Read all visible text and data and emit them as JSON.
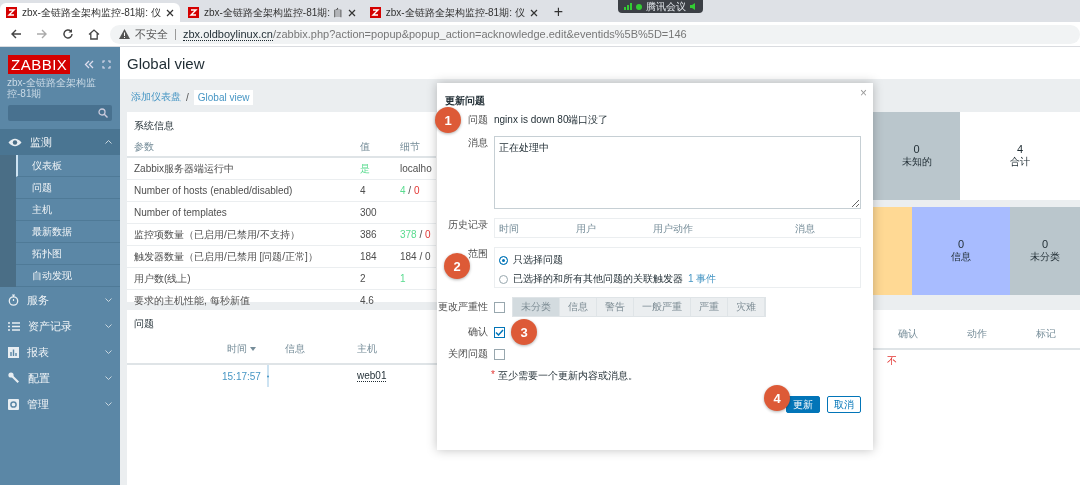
{
  "browser": {
    "tabs": [
      {
        "title": "zbx-全链路全架构监控-81期: 仪",
        "selected": true
      },
      {
        "title": "zbx-全链路全架构监控-81期: 自",
        "selected": false
      },
      {
        "title": "zbx-全链路全架构监控-81期: 仪",
        "selected": false
      }
    ],
    "new_tab": "+",
    "security": "不安全",
    "url_host": "zbx.oldboylinux.cn",
    "url_path": "/zabbix.php?action=popup&popup_action=acknowledge.edit&eventids%5B%5D=146"
  },
  "meeting_indicator": {
    "label": "腾讯会议"
  },
  "sidebar": {
    "logo": "ZABBIX",
    "server_name": "zbx-全链路全架构监控-81期",
    "menu": [
      {
        "label": "监测",
        "expanded": true,
        "children": [
          {
            "label": "仪表板",
            "selected": true
          },
          {
            "label": "问题",
            "selected": false
          },
          {
            "label": "主机",
            "selected": false
          },
          {
            "label": "最新数据",
            "selected": false
          },
          {
            "label": "拓扑图",
            "selected": false
          },
          {
            "label": "自动发现",
            "selected": false
          }
        ]
      },
      {
        "label": "服务",
        "expanded": false
      },
      {
        "label": "资产记录",
        "expanded": false
      },
      {
        "label": "报表",
        "expanded": false
      },
      {
        "label": "配置",
        "expanded": false
      },
      {
        "label": "管理",
        "expanded": false
      }
    ]
  },
  "page": {
    "title": "Global view",
    "breadcrumb": [
      "添加仪表盘",
      "Global view"
    ],
    "breadcrumb_separator": "/"
  },
  "system_info": {
    "title": "系统信息",
    "columns": [
      "参数",
      "值",
      "细节"
    ],
    "rows": [
      {
        "param": "Zabbix服务器端运行中",
        "value": [
          {
            "text": "是",
            "kind": "ok"
          }
        ],
        "details": [
          {
            "text": "localho",
            "kind": "plain"
          }
        ]
      },
      {
        "param": "Number of hosts (enabled/disabled)",
        "value": [
          {
            "text": "4",
            "kind": "plain"
          }
        ],
        "details": [
          {
            "text": "4",
            "kind": "ok"
          },
          {
            "text": " / ",
            "kind": "plain"
          },
          {
            "text": "0",
            "kind": "bad"
          }
        ]
      },
      {
        "param": "Number of templates",
        "value": [
          {
            "text": "300",
            "kind": "plain"
          }
        ],
        "details": []
      },
      {
        "param": "监控项数量（已启用/已禁用/不支持）",
        "value": [
          {
            "text": "386",
            "kind": "plain"
          }
        ],
        "details": [
          {
            "text": "378",
            "kind": "ok"
          },
          {
            "text": " / ",
            "kind": "plain"
          },
          {
            "text": "0",
            "kind": "bad"
          }
        ]
      },
      {
        "param": "触发器数量（已启用/已禁用 [问题/正常]）",
        "value": [
          {
            "text": "184",
            "kind": "plain"
          }
        ],
        "details": [
          {
            "text": "184 / 0",
            "kind": "plain"
          }
        ]
      },
      {
        "param": "用户数(线上)",
        "value": [
          {
            "text": "2",
            "kind": "plain"
          }
        ],
        "details": [
          {
            "text": "1",
            "kind": "ok"
          }
        ]
      },
      {
        "param": "要求的主机性能, 每秒新值",
        "value": [
          {
            "text": "4.6",
            "kind": "plain"
          }
        ],
        "details": []
      }
    ]
  },
  "host_status_tiles": [
    {
      "value": "0",
      "label": "未知的",
      "color": "#bac6cc"
    },
    {
      "value": "4",
      "label": "合计",
      "color": "#ffffff"
    }
  ],
  "severity_tiles": [
    {
      "color": "#ffd994"
    },
    {
      "value": "0",
      "label": "信息",
      "color": "#a8bcff"
    },
    {
      "value": "0",
      "label": "未分类",
      "color": "#bac6cc"
    }
  ],
  "problems": {
    "title": "问题",
    "columns": [
      {
        "label": "时间",
        "sorted": true
      },
      {
        "label": "信息",
        "sorted": false
      },
      {
        "label": "主机",
        "sorted": false
      },
      {
        "label": "确认",
        "sorted": false
      },
      {
        "label": "动作",
        "sorted": false
      },
      {
        "label": "标记",
        "sorted": false
      }
    ],
    "rows": [
      {
        "time": "15:17:57",
        "host": "web01",
        "ack": "不"
      }
    ]
  },
  "dialog": {
    "title": "更新问题",
    "close": "×",
    "problem": {
      "label": "问题",
      "value": "nginx is down 80端口没了"
    },
    "message": {
      "label": "消息",
      "value": "正在处理中"
    },
    "history": {
      "label": "历史记录",
      "columns": [
        "时间",
        "用户",
        "用户动作",
        "消息"
      ]
    },
    "scope": {
      "label": "范围",
      "options": [
        {
          "label": "只选择问题",
          "selected": true
        },
        {
          "label": "已选择的和所有其他问题的关联触发器",
          "link": "1 事件",
          "selected": false
        }
      ]
    },
    "change_severity": {
      "label": "更改严重性",
      "checked": false,
      "disabled": true,
      "options": [
        {
          "label": "未分类",
          "selected": true
        },
        {
          "label": "信息",
          "selected": false
        },
        {
          "label": "警告",
          "selected": false
        },
        {
          "label": "一般严重",
          "selected": false
        },
        {
          "label": "严重",
          "selected": false
        },
        {
          "label": "灾难",
          "selected": false
        }
      ]
    },
    "acknowledge": {
      "label": "确认",
      "checked": true
    },
    "close_problem": {
      "label": "关闭问题",
      "checked": false
    },
    "note": {
      "mark": "*",
      "text": "至少需要一个更新内容或消息。"
    },
    "buttons": [
      {
        "label": "更新",
        "kind": "primary"
      },
      {
        "label": "取消",
        "kind": "secondary"
      }
    ]
  },
  "step_badges": [
    "1",
    "2",
    "3",
    "4"
  ]
}
